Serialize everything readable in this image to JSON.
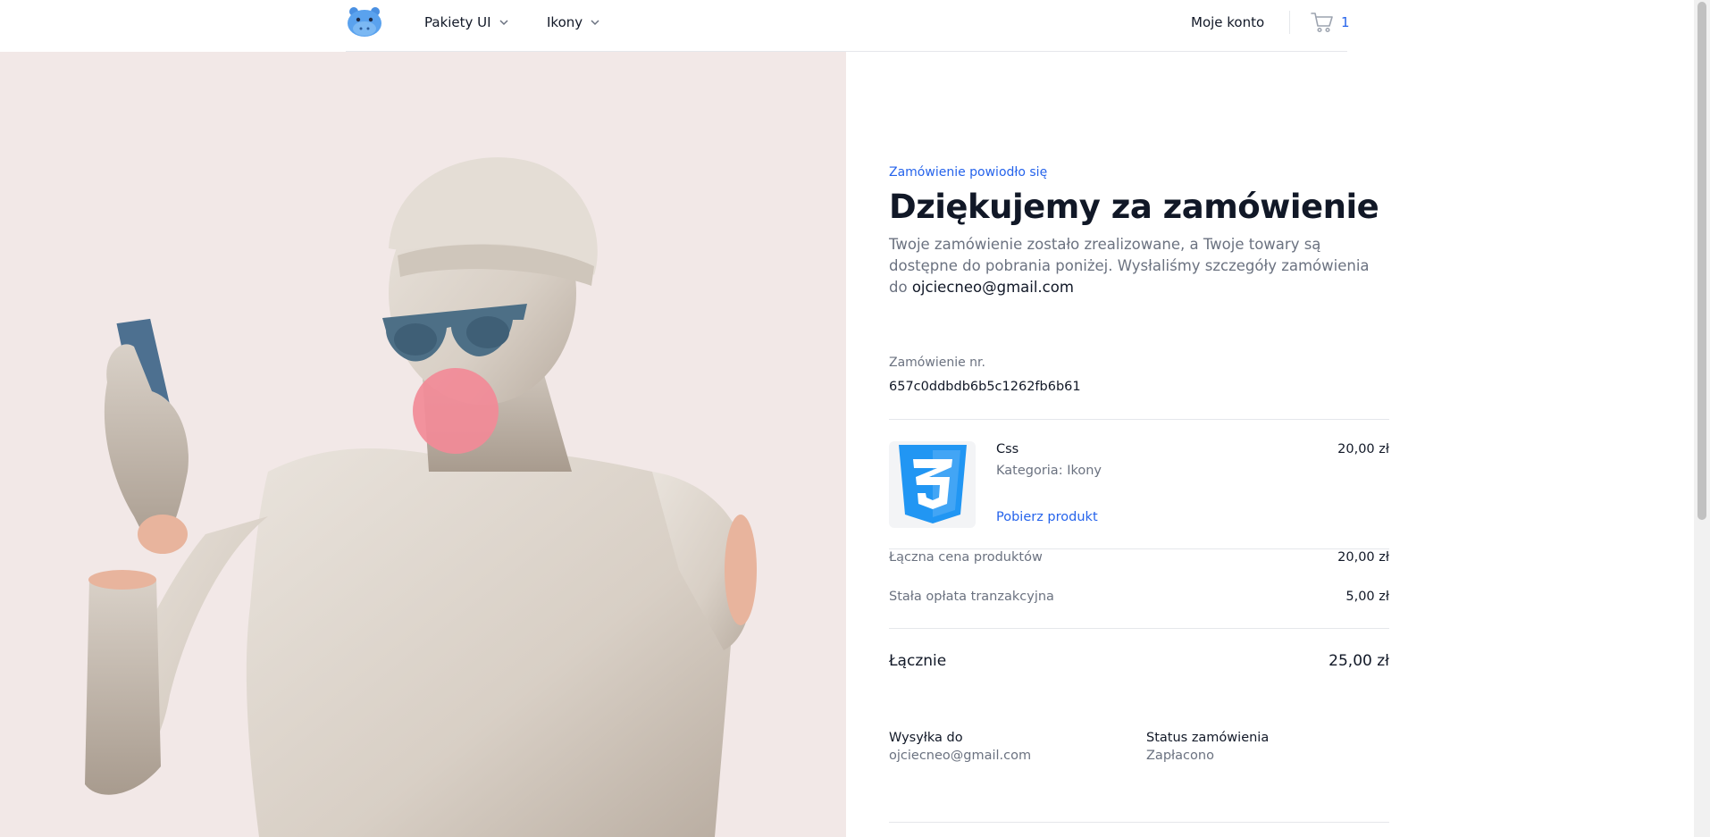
{
  "nav": {
    "items": [
      {
        "label": "Pakiety UI"
      },
      {
        "label": "Ikony"
      }
    ],
    "account_label": "Moje konto",
    "cart_count": "1"
  },
  "order": {
    "eyebrow": "Zamówienie powiodło się",
    "title": "Dziękujemy za zamówienie",
    "description": "Twoje zamówienie zostało zrealizowane, a Twoje towary są dostępne do pobrania poniżej. Wysłaliśmy szczegóły zamówienia do",
    "email": "ojciecneo@gmail.com",
    "number_label": "Zamówienie nr.",
    "number": "657c0ddbdb6b5c1262fb6b61"
  },
  "product": {
    "name": "Css",
    "category": "Kategoria: Ikony",
    "download_label": "Pobierz produkt",
    "price": "20,00 zł",
    "icon": "css3-icon"
  },
  "summary": {
    "products_label": "Łączna cena produktów",
    "products_value": "20,00 zł",
    "fee_label": "Stała opłata tranzakcyjna",
    "fee_value": "5,00 zł",
    "total_label": "Łącznie",
    "total_value": "25,00 zł"
  },
  "shipping": {
    "title": "Wysyłka do",
    "value": "ojciecneo@gmail.com"
  },
  "status": {
    "title": "Status zamówienia",
    "value": "Zapłacono"
  },
  "colors": {
    "accent": "#2563eb",
    "hero_background": "#f2e8e7",
    "css_badge": "#2196f3"
  }
}
